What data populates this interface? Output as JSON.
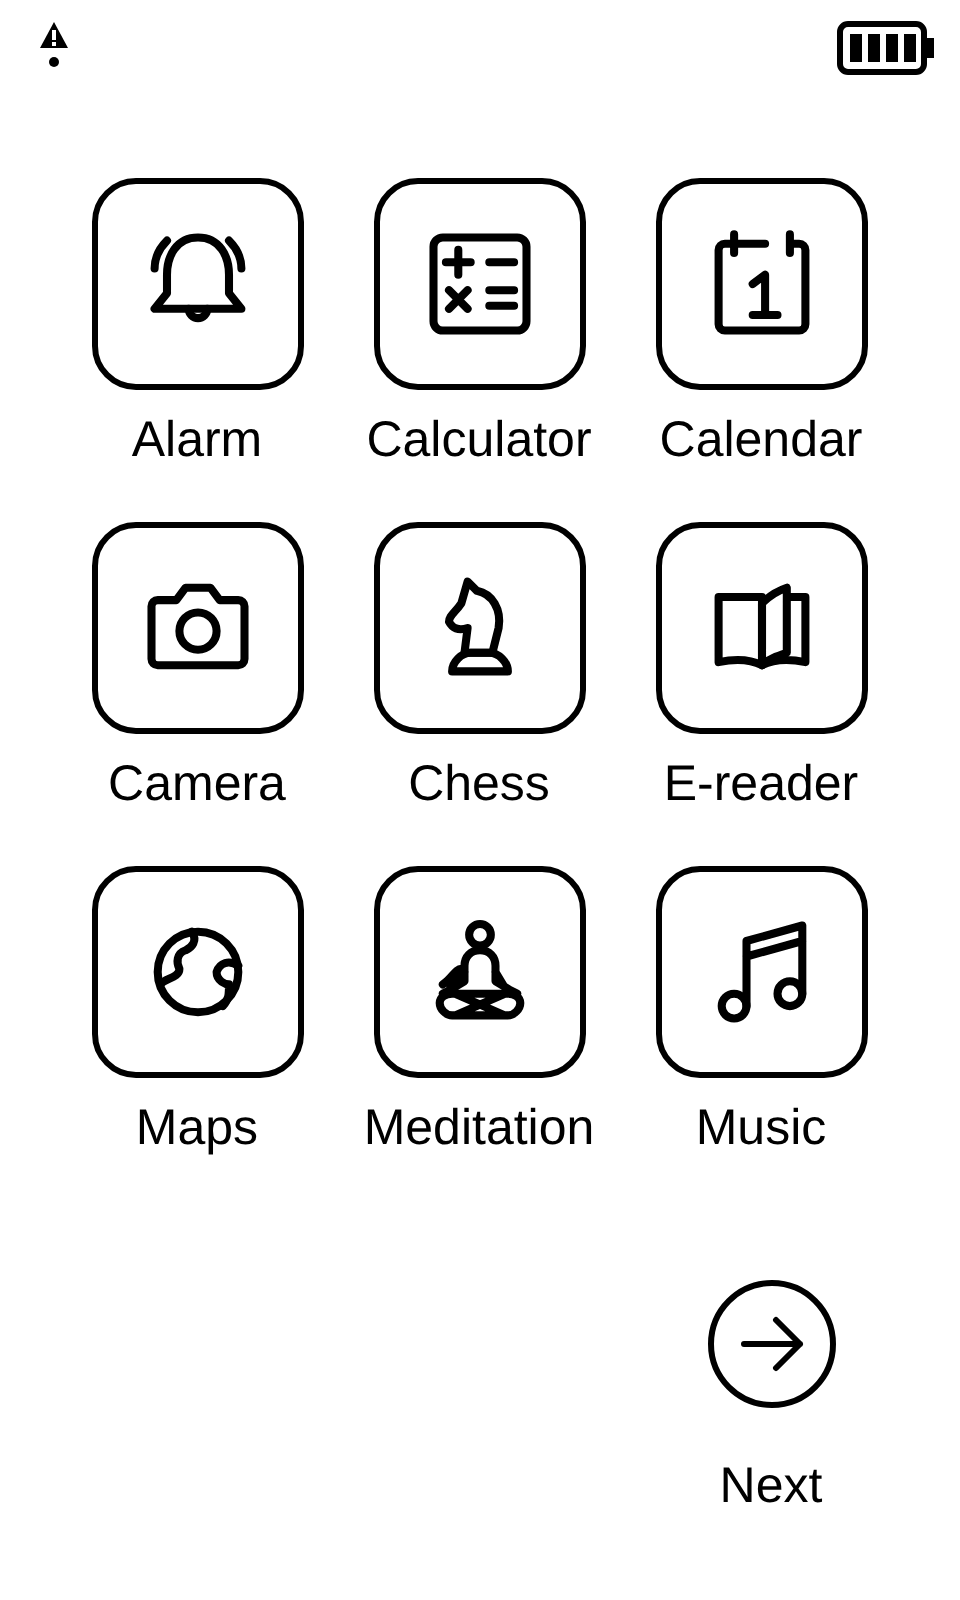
{
  "status_bar": {
    "alert": true
  },
  "apps": [
    {
      "label": "Alarm",
      "kind": "alarm"
    },
    {
      "label": "Calculator",
      "kind": "calculator"
    },
    {
      "label": "Calendar",
      "kind": "calendar"
    },
    {
      "label": "Camera",
      "kind": "camera"
    },
    {
      "label": "Chess",
      "kind": "chess"
    },
    {
      "label": "E-reader",
      "kind": "ereader"
    },
    {
      "label": "Maps",
      "kind": "maps"
    },
    {
      "label": "Meditation",
      "kind": "meditation"
    },
    {
      "label": "Music",
      "kind": "music"
    }
  ],
  "next_button": {
    "label": "Next"
  }
}
